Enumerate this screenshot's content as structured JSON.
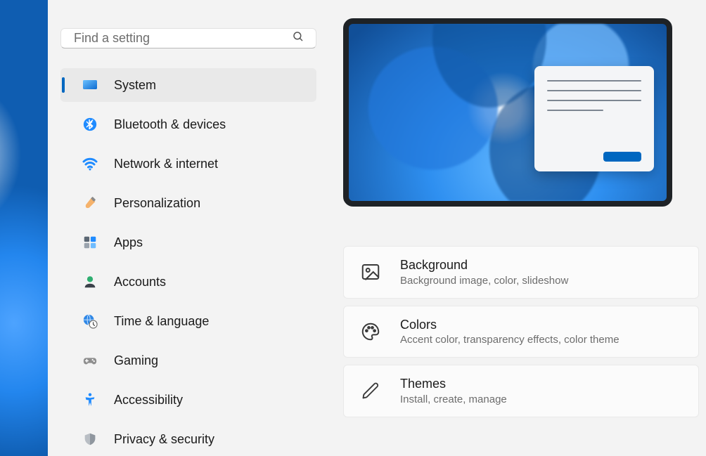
{
  "colors": {
    "accent": "#0067c0"
  },
  "search": {
    "placeholder": "Find a setting"
  },
  "sidebar": {
    "items": [
      {
        "id": "system",
        "label": "System",
        "icon": "monitor-icon",
        "selected": true
      },
      {
        "id": "bluetooth",
        "label": "Bluetooth & devices",
        "icon": "bluetooth-icon",
        "selected": false
      },
      {
        "id": "network",
        "label": "Network & internet",
        "icon": "wifi-icon",
        "selected": false
      },
      {
        "id": "personalization",
        "label": "Personalization",
        "icon": "paintbrush-icon",
        "selected": false
      },
      {
        "id": "apps",
        "label": "Apps",
        "icon": "apps-icon",
        "selected": false
      },
      {
        "id": "accounts",
        "label": "Accounts",
        "icon": "person-icon",
        "selected": false
      },
      {
        "id": "time-language",
        "label": "Time & language",
        "icon": "globe-clock-icon",
        "selected": false
      },
      {
        "id": "gaming",
        "label": "Gaming",
        "icon": "gamepad-icon",
        "selected": false
      },
      {
        "id": "accessibility",
        "label": "Accessibility",
        "icon": "accessibility-icon",
        "selected": false
      },
      {
        "id": "privacy",
        "label": "Privacy & security",
        "icon": "shield-icon",
        "selected": false
      }
    ]
  },
  "main": {
    "cards": [
      {
        "id": "background",
        "title": "Background",
        "subtitle": "Background image, color, slideshow",
        "icon": "picture-icon"
      },
      {
        "id": "colors",
        "title": "Colors",
        "subtitle": "Accent color, transparency effects, color theme",
        "icon": "palette-icon"
      },
      {
        "id": "themes",
        "title": "Themes",
        "subtitle": "Install, create, manage",
        "icon": "pen-icon"
      }
    ]
  }
}
